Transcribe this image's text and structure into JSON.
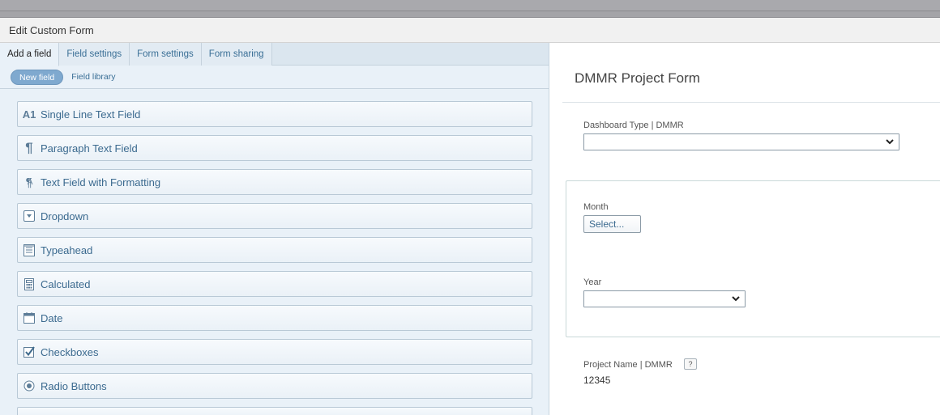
{
  "dialog": {
    "title": "Edit Custom Form"
  },
  "tabs": [
    {
      "label": "Add a field",
      "active": true
    },
    {
      "label": "Field settings",
      "active": false
    },
    {
      "label": "Form settings",
      "active": false
    },
    {
      "label": "Form sharing",
      "active": false
    }
  ],
  "subtabs": {
    "new_field": "New field",
    "field_library": "Field library"
  },
  "field_types": [
    {
      "label": "Single Line Text Field",
      "icon": "text-a1-icon"
    },
    {
      "label": "Paragraph Text Field",
      "icon": "paragraph-icon"
    },
    {
      "label": "Text Field with Formatting",
      "icon": "formatted-text-icon"
    },
    {
      "label": "Dropdown",
      "icon": "dropdown-icon"
    },
    {
      "label": "Typeahead",
      "icon": "typeahead-icon"
    },
    {
      "label": "Calculated",
      "icon": "calculator-icon"
    },
    {
      "label": "Date",
      "icon": "calendar-icon"
    },
    {
      "label": "Checkboxes",
      "icon": "checkbox-icon"
    },
    {
      "label": "Radio Buttons",
      "icon": "radio-icon"
    }
  ],
  "form": {
    "title": "DMMR Project Form",
    "dashboard_type": {
      "label": "Dashboard Type | DMMR",
      "value": ""
    },
    "month": {
      "label": "Month",
      "button": "Select..."
    },
    "year": {
      "label": "Year",
      "value": ""
    },
    "project_name": {
      "label": "Project Name | DMMR",
      "help": "?",
      "value": "12345"
    }
  },
  "colors": {
    "accent": "#3b6a8f",
    "pill": "#7fa9cf",
    "left_bg": "#e9f1f8"
  }
}
